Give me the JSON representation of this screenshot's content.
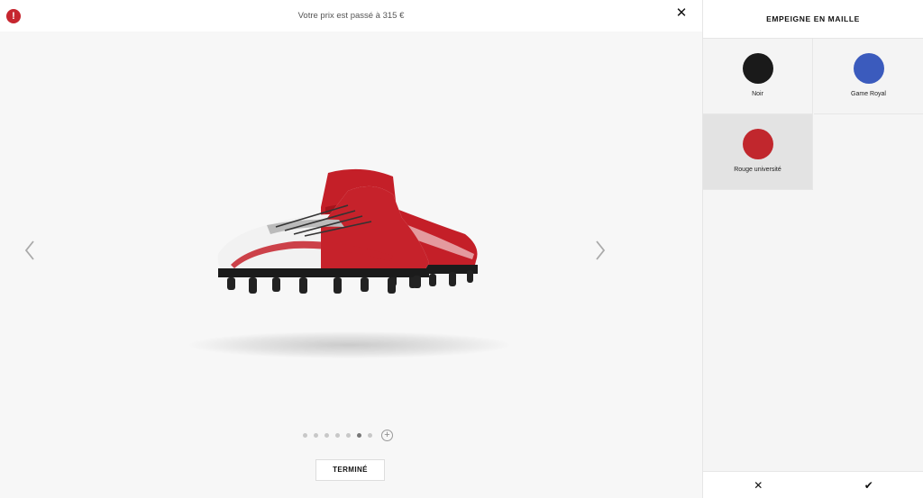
{
  "topbar": {
    "alert_icon": "exclamation-circle-icon",
    "message": "Votre prix est passé à 315 €",
    "close_symbol": "✕"
  },
  "viewer": {
    "prev_icon": "chevron-left-icon",
    "next_icon": "chevron-right-icon",
    "view_dots": {
      "count": 7,
      "active_index": 5
    },
    "add_view_symbol": "+",
    "done_label": "TERMINÉ"
  },
  "panel": {
    "title": "EMPEIGNE EN MAILLE",
    "swatches": [
      {
        "label": "Noir",
        "color": "#1a1a1a",
        "selected": false
      },
      {
        "label": "Game Royal",
        "color": "#3b5bbd",
        "selected": false
      },
      {
        "label": "Rouge université",
        "color": "#c1272d",
        "selected": true
      }
    ],
    "cancel_symbol": "✕",
    "confirm_symbol": "✔"
  },
  "colors": {
    "accent_red": "#c1272d",
    "background": "#f7f7f7"
  }
}
